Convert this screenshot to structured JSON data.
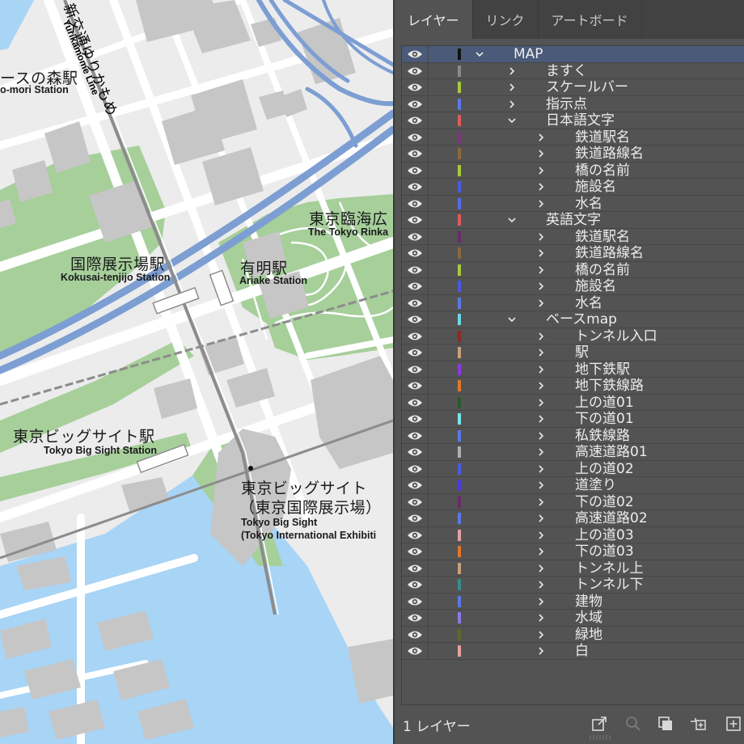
{
  "panel": {
    "tabs": [
      {
        "label": "レイヤー",
        "active": true
      },
      {
        "label": "リンク",
        "active": false
      },
      {
        "label": "アートボード",
        "active": false
      }
    ],
    "layers": [
      {
        "name": "MAP",
        "depth": 0,
        "expanded": true,
        "color": "#111111",
        "selected": true
      },
      {
        "name": "ますく",
        "depth": 1,
        "expanded": false,
        "color": "#8a8a8a"
      },
      {
        "name": "スケールバー",
        "depth": 1,
        "expanded": false,
        "color": "#a8c83c"
      },
      {
        "name": "指示点",
        "depth": 1,
        "expanded": false,
        "color": "#5a78e6"
      },
      {
        "name": "日本語文字",
        "depth": 1,
        "expanded": true,
        "color": "#e05a5a"
      },
      {
        "name": "鉄道駅名",
        "depth": 2,
        "expanded": false,
        "color": "#7a3a7a"
      },
      {
        "name": "鉄道路線名",
        "depth": 2,
        "expanded": false,
        "color": "#8a6a3a"
      },
      {
        "name": "橋の名前",
        "depth": 2,
        "expanded": false,
        "color": "#a8c83c"
      },
      {
        "name": "施設名",
        "depth": 2,
        "expanded": false,
        "color": "#4a5ae0"
      },
      {
        "name": "水名",
        "depth": 2,
        "expanded": false,
        "color": "#5a6ae6"
      },
      {
        "name": "英語文字",
        "depth": 1,
        "expanded": true,
        "color": "#e05a5a"
      },
      {
        "name": "鉄道駅名",
        "depth": 2,
        "expanded": false,
        "color": "#6a2a6a"
      },
      {
        "name": "鉄道路線名",
        "depth": 2,
        "expanded": false,
        "color": "#8a6a3a"
      },
      {
        "name": "橋の名前",
        "depth": 2,
        "expanded": false,
        "color": "#a8c83c"
      },
      {
        "name": "施設名",
        "depth": 2,
        "expanded": false,
        "color": "#4a5ae0"
      },
      {
        "name": "水名",
        "depth": 2,
        "expanded": false,
        "color": "#5a78e6"
      },
      {
        "name": "ベースmap",
        "depth": 1,
        "expanded": true,
        "color": "#6ad8e6"
      },
      {
        "name": "トンネル入口",
        "depth": 2,
        "expanded": false,
        "color": "#8a2a2a"
      },
      {
        "name": "駅",
        "depth": 2,
        "expanded": false,
        "color": "#c8a07a"
      },
      {
        "name": "地下鉄駅",
        "depth": 2,
        "expanded": false,
        "color": "#8a3ae0"
      },
      {
        "name": "地下鉄線路",
        "depth": 2,
        "expanded": false,
        "color": "#e0782a"
      },
      {
        "name": "上の道01",
        "depth": 2,
        "expanded": false,
        "color": "#2a5a2a"
      },
      {
        "name": "下の道01",
        "depth": 2,
        "expanded": false,
        "color": "#7ae6e6"
      },
      {
        "name": "私鉄線路",
        "depth": 2,
        "expanded": false,
        "color": "#5a78e6"
      },
      {
        "name": "高速道路01",
        "depth": 2,
        "expanded": false,
        "color": "#b0b0b0"
      },
      {
        "name": "上の道02",
        "depth": 2,
        "expanded": false,
        "color": "#4a5ae0"
      },
      {
        "name": "道塗り",
        "depth": 2,
        "expanded": false,
        "color": "#4a3ae0"
      },
      {
        "name": "下の道02",
        "depth": 2,
        "expanded": false,
        "color": "#6a2a6a"
      },
      {
        "name": "高速道路02",
        "depth": 2,
        "expanded": false,
        "color": "#5a78e6"
      },
      {
        "name": "上の道03",
        "depth": 2,
        "expanded": false,
        "color": "#e6a0a0"
      },
      {
        "name": "下の道03",
        "depth": 2,
        "expanded": false,
        "color": "#e0782a"
      },
      {
        "name": "トンネル上",
        "depth": 2,
        "expanded": false,
        "color": "#c8a07a"
      },
      {
        "name": "トンネル下",
        "depth": 2,
        "expanded": false,
        "color": "#3a8a8a"
      },
      {
        "name": "建物",
        "depth": 2,
        "expanded": false,
        "color": "#5a78e6"
      },
      {
        "name": "水域",
        "depth": 2,
        "expanded": false,
        "color": "#8a7ae6"
      },
      {
        "name": "緑地",
        "depth": 2,
        "expanded": false,
        "color": "#5a6a2a"
      },
      {
        "name": "白",
        "depth": 2,
        "expanded": false,
        "color": "#e6a0a0"
      }
    ],
    "footer": {
      "layer_count": "1 レイヤー"
    }
  },
  "map": {
    "colors": {
      "water": "#a8d4f6",
      "green": "#a6cf9a",
      "road": "#ffffff",
      "building": "#c6c6c6",
      "highway": "#7d9ed2",
      "rail": "#8c8c8c"
    },
    "labels": {
      "yurikamome_jp": "新交通ゆりかもめ",
      "yurikamome_en": "Yurikamome Line",
      "mori_jp": "ースの森駅",
      "mori_en": "o-mori Station",
      "kokusai_jp": "国際展示場駅",
      "kokusai_en": "Kokusai-tenjijo Station",
      "ariake_jp": "有明駅",
      "ariake_en": "Ariake Station",
      "rinkai_jp": "東京臨海広",
      "rinkai_en": "The Tokyo Rinka",
      "bigsight_st_jp": "東京ビッグサイト駅",
      "bigsight_st_en": "Tokyo Big Sight Station",
      "bigsight_jp1": "東京ビッグサイト",
      "bigsight_jp2": "（東京国際展示場）",
      "bigsight_en1": "Tokyo Big Sight",
      "bigsight_en2": "(Tokyo International Exhibiti"
    }
  }
}
